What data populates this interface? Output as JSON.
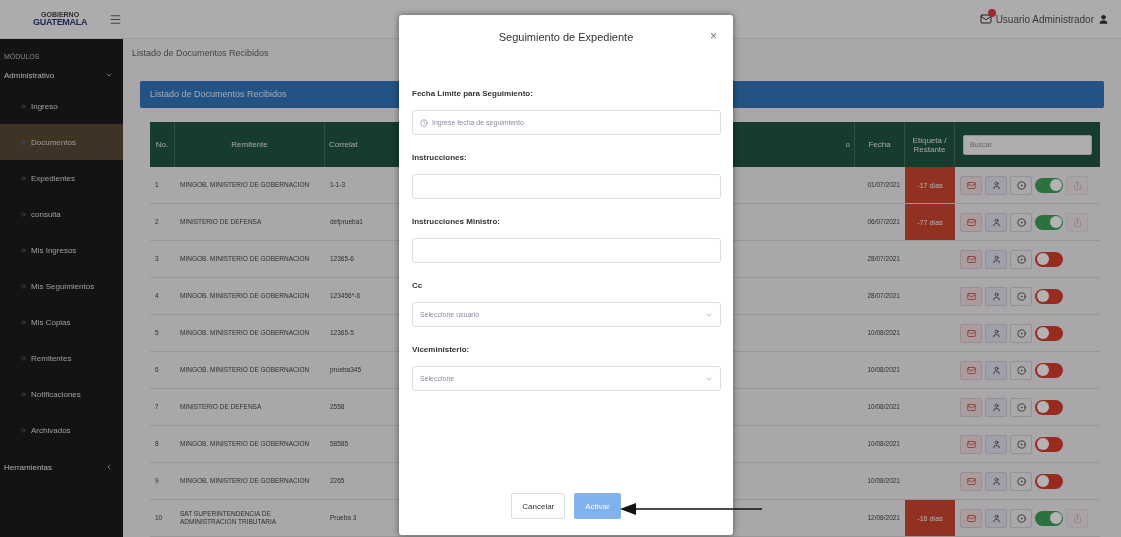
{
  "topbar": {
    "logo_top": "GOBIERNO",
    "logo_bottom": "GUATEMALA",
    "user_name": "Usuario Administrador"
  },
  "sidebar": {
    "section_label": "MÓDULOS",
    "groups": [
      {
        "label": "Administrativo",
        "expanded": true,
        "items": [
          {
            "label": "Ingreso",
            "selected": false
          },
          {
            "label": "Documentos",
            "selected": true
          },
          {
            "label": "Expedientes",
            "selected": false
          },
          {
            "label": "consulta",
            "selected": false
          },
          {
            "label": "Mis Ingresos",
            "selected": false
          },
          {
            "label": "Mis Seguimientos",
            "selected": false
          },
          {
            "label": "Mis Copias",
            "selected": false
          },
          {
            "label": "Remitentes",
            "selected": false
          },
          {
            "label": "Notificaciones",
            "selected": false
          },
          {
            "label": "Archivados",
            "selected": false
          }
        ]
      },
      {
        "label": "Herramientas",
        "expanded": false
      }
    ]
  },
  "breadcrumb": "Listado de Documentos Recibidos",
  "panel": {
    "title": "Listado de Documentos Recibidos",
    "columns": [
      {
        "label": "No."
      },
      {
        "label": "Remitente"
      },
      {
        "label": "Correlat"
      },
      {
        "label": "o"
      },
      {
        "label": "Fecha"
      },
      {
        "label": "Etiqueta / Restante"
      }
    ],
    "search": {
      "placeholder": "Buscar"
    },
    "rows": [
      {
        "no": "1",
        "remitente": "MINGOB. MINISTERIO DE GOBERNACION",
        "correlativo": "1-1-3",
        "fecha": "01/07/2021",
        "restante": "-17 días",
        "active": true
      },
      {
        "no": "2",
        "remitente": "MINISTERIO DE DEFENSA",
        "correlativo": "defprueba1",
        "fecha": "06/07/2021",
        "restante": "-77 días",
        "active": true
      },
      {
        "no": "3",
        "remitente": "MINGOB. MINISTERIO DE GOBERNACION",
        "correlativo": "12365-6",
        "fecha": "28/07/2021",
        "active": false
      },
      {
        "no": "4",
        "remitente": "MINGOB. MINISTERIO DE GOBERNACION",
        "correlativo": "123456*-6",
        "fecha": "28/07/2021",
        "active": false
      },
      {
        "no": "5",
        "remitente": "MINGOB. MINISTERIO DE GOBERNACION",
        "correlativo": "12365-5",
        "fecha": "10/08/2021",
        "active": false
      },
      {
        "no": "6",
        "remitente": "MINGOB. MINISTERIO DE GOBERNACION",
        "correlativo": "prueba345",
        "fecha": "10/08/2021",
        "active": false
      },
      {
        "no": "7",
        "remitente": "MINISTERIO DE DEFENSA",
        "correlativo": "2558",
        "fecha": "10/08/2021",
        "active": false
      },
      {
        "no": "8",
        "remitente": "MINGOB. MINISTERIO DE GOBERNACION",
        "correlativo": "58585",
        "fecha": "10/08/2021",
        "active": false
      },
      {
        "no": "9",
        "remitente": "MINGOB. MINISTERIO DE GOBERNACION",
        "correlativo": "2265",
        "fecha": "10/08/2021",
        "active": false
      },
      {
        "no": "10",
        "remitente": "SAT SUPERINTENDENCIA DE ADMINISTRACION TRIBUTARIA",
        "correlativo": "Prueba 3",
        "fecha": "12/08/2021",
        "restante": "-16 días",
        "active": true
      }
    ]
  },
  "modal": {
    "title": "Seguimiento de Expediente",
    "close": "×",
    "fields": [
      {
        "kind": "date",
        "label": "Fecha Límite para Seguimiento:",
        "placeholder": "Ingrese fecha de seguimiento"
      },
      {
        "kind": "text",
        "label": "Instrucciones:"
      },
      {
        "kind": "text",
        "label": "Instrucciones Ministro:"
      },
      {
        "kind": "select",
        "label": "Cc",
        "placeholder": "Seleccione usuario"
      },
      {
        "kind": "select",
        "label": "Viceministerio:",
        "placeholder": "Seleccione"
      }
    ],
    "buttons": [
      {
        "label": "Cancelar",
        "kind": "secondary",
        "disabled": false
      },
      {
        "label": "Activar",
        "kind": "primary",
        "disabled": true
      }
    ]
  }
}
